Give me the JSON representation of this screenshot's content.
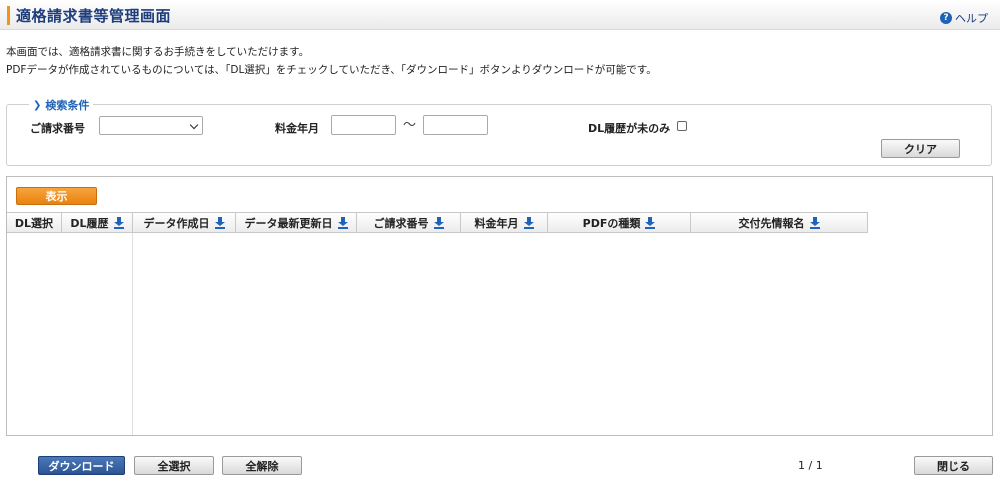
{
  "header": {
    "title": "適格請求書等管理画面",
    "help_label": "ヘルプ"
  },
  "intro": {
    "line1": "本画面では、適格請求書に関するお手続きをしていただけます。",
    "line2": "PDFデータが作成されているものについては、「DL選択」をチェックしていただき、「ダウンロード」ボタンよりダウンロードが可能です。"
  },
  "search": {
    "legend": "検索条件",
    "invoice_number_label": "ご請求番号",
    "invoice_number_value": "",
    "billing_month_label": "料金年月",
    "billing_from": "",
    "range_separator": "〜",
    "billing_to": "",
    "undownloaded_only_label": "DL履歴が未のみ",
    "undownloaded_only_checked": false,
    "clear_label": "クリア"
  },
  "results": {
    "show_label": "表示",
    "columns": [
      {
        "label": "DL選択",
        "sortable": false
      },
      {
        "label": "DL履歴",
        "sortable": true
      },
      {
        "label": "データ作成日",
        "sortable": true
      },
      {
        "label": "データ最新更新日",
        "sortable": true
      },
      {
        "label": "ご請求番号",
        "sortable": true
      },
      {
        "label": "料金年月",
        "sortable": true
      },
      {
        "label": "PDFの種類",
        "sortable": true
      },
      {
        "label": "交付先情報名",
        "sortable": true
      }
    ],
    "rows": []
  },
  "footer": {
    "download_label": "ダウンロード",
    "select_all_label": "全選択",
    "deselect_all_label": "全解除",
    "pagination": "1 / 1",
    "close_label": "閉じる"
  },
  "colors": {
    "accent": "#f0931f",
    "title": "#1e3d7b",
    "link": "#1e63b8"
  }
}
